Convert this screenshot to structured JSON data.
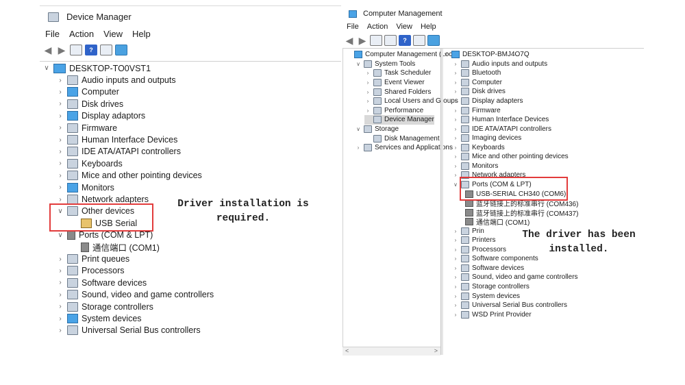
{
  "device_manager": {
    "title": "Device Manager",
    "menu": [
      "File",
      "Action",
      "View",
      "Help"
    ],
    "root": "DESKTOP-TO0VST1",
    "items": [
      {
        "label": "Audio inputs and outputs",
        "expanded": false,
        "icon": "speaker-icon"
      },
      {
        "label": "Computer",
        "expanded": false,
        "icon": "computer-icon"
      },
      {
        "label": "Disk drives",
        "expanded": false,
        "icon": "disk-icon"
      },
      {
        "label": "Display adaptors",
        "expanded": false,
        "icon": "display-icon"
      },
      {
        "label": "Firmware",
        "expanded": false,
        "icon": "chip-icon"
      },
      {
        "label": "Human Interface Devices",
        "expanded": false,
        "icon": "hid-icon"
      },
      {
        "label": "IDE ATA/ATAPI controllers",
        "expanded": false,
        "icon": "ide-icon"
      },
      {
        "label": "Keyboards",
        "expanded": false,
        "icon": "keyboard-icon"
      },
      {
        "label": "Mice and other pointing devices",
        "expanded": false,
        "icon": "mouse-icon"
      },
      {
        "label": "Monitors",
        "expanded": false,
        "icon": "monitor-icon"
      },
      {
        "label": "Network adapters",
        "expanded": false,
        "icon": "network-icon"
      },
      {
        "label": "Other devices",
        "expanded": true,
        "icon": "unknown-device-icon"
      },
      {
        "label": "USB Serial",
        "child": true,
        "icon": "warning-icon"
      },
      {
        "label": "Ports (COM & LPT)",
        "expanded": true,
        "icon": "port-icon"
      },
      {
        "label": "通信端口 (COM1)",
        "child": true,
        "icon": "port-icon"
      },
      {
        "label": "Print queues",
        "expanded": false,
        "icon": "printer-icon"
      },
      {
        "label": "Processors",
        "expanded": false,
        "icon": "processor-icon"
      },
      {
        "label": "Software devices",
        "expanded": false,
        "icon": "software-icon"
      },
      {
        "label": "Sound, video and game controllers",
        "expanded": false,
        "icon": "speaker-icon"
      },
      {
        "label": "Storage controllers",
        "expanded": false,
        "icon": "storage-icon"
      },
      {
        "label": "System devices",
        "expanded": false,
        "icon": "system-icon"
      },
      {
        "label": "Universal Serial Bus controllers",
        "expanded": false,
        "icon": "usb-icon"
      }
    ],
    "annotation": [
      "Driver installation is",
      "required."
    ]
  },
  "computer_management": {
    "title": "Computer Management",
    "menu": [
      "File",
      "Action",
      "View",
      "Help"
    ],
    "left_tree": [
      {
        "label": "Computer Management (Local",
        "level": 0,
        "chev": ""
      },
      {
        "label": "System Tools",
        "level": 1,
        "chev": "v"
      },
      {
        "label": "Task Scheduler",
        "level": 2,
        "chev": ">"
      },
      {
        "label": "Event Viewer",
        "level": 2,
        "chev": ">"
      },
      {
        "label": "Shared Folders",
        "level": 2,
        "chev": ">"
      },
      {
        "label": "Local Users and Groups",
        "level": 2,
        "chev": ">"
      },
      {
        "label": "Performance",
        "level": 2,
        "chev": ">"
      },
      {
        "label": "Device Manager",
        "level": 2,
        "chev": "",
        "selected": true
      },
      {
        "label": "Storage",
        "level": 1,
        "chev": "v"
      },
      {
        "label": "Disk Management",
        "level": 2,
        "chev": ""
      },
      {
        "label": "Services and Applications",
        "level": 1,
        "chev": ">"
      }
    ],
    "root": "DESKTOP-BMJ4O7Q",
    "right_tree": [
      {
        "label": "Audio inputs and outputs",
        "chev": ">"
      },
      {
        "label": "Bluetooth",
        "chev": ">"
      },
      {
        "label": "Computer",
        "chev": ">"
      },
      {
        "label": "Disk drives",
        "chev": ">"
      },
      {
        "label": "Display adapters",
        "chev": ">"
      },
      {
        "label": "Firmware",
        "chev": ">"
      },
      {
        "label": "Human Interface Devices",
        "chev": ">"
      },
      {
        "label": "IDE ATA/ATAPI controllers",
        "chev": ">"
      },
      {
        "label": "Imaging devices",
        "chev": ">"
      },
      {
        "label": "Keyboards",
        "chev": ">"
      },
      {
        "label": "Mice and other pointing devices",
        "chev": ">"
      },
      {
        "label": "Monitors",
        "chev": ">"
      },
      {
        "label": "Network adapters",
        "chev": ">"
      },
      {
        "label": "Ports (COM & LPT)",
        "chev": "v"
      },
      {
        "label": "USB-SERIAL CH340 (COM6)",
        "child": true
      },
      {
        "label": "蓝牙链接上的标准串行 (COM436)",
        "child": true
      },
      {
        "label": "蓝牙链接上的标准串行 (COM437)",
        "child": true
      },
      {
        "label": "通信端口 (COM1)",
        "child": true
      },
      {
        "label": "Prin",
        "chev": ">"
      },
      {
        "label": "Printers",
        "chev": ">"
      },
      {
        "label": "Processors",
        "chev": ">"
      },
      {
        "label": "Software components",
        "chev": ">"
      },
      {
        "label": "Software devices",
        "chev": ">"
      },
      {
        "label": "Sound, video and game controllers",
        "chev": ">"
      },
      {
        "label": "Storage controllers",
        "chev": ">"
      },
      {
        "label": "System devices",
        "chev": ">"
      },
      {
        "label": "Universal Serial Bus controllers",
        "chev": ">"
      },
      {
        "label": "WSD Print Provider",
        "chev": ">"
      }
    ],
    "annotation": [
      "The driver has been",
      "installed."
    ]
  },
  "colors": {
    "highlight_box": "#e23b3b",
    "selection": "#d9d9d9"
  }
}
